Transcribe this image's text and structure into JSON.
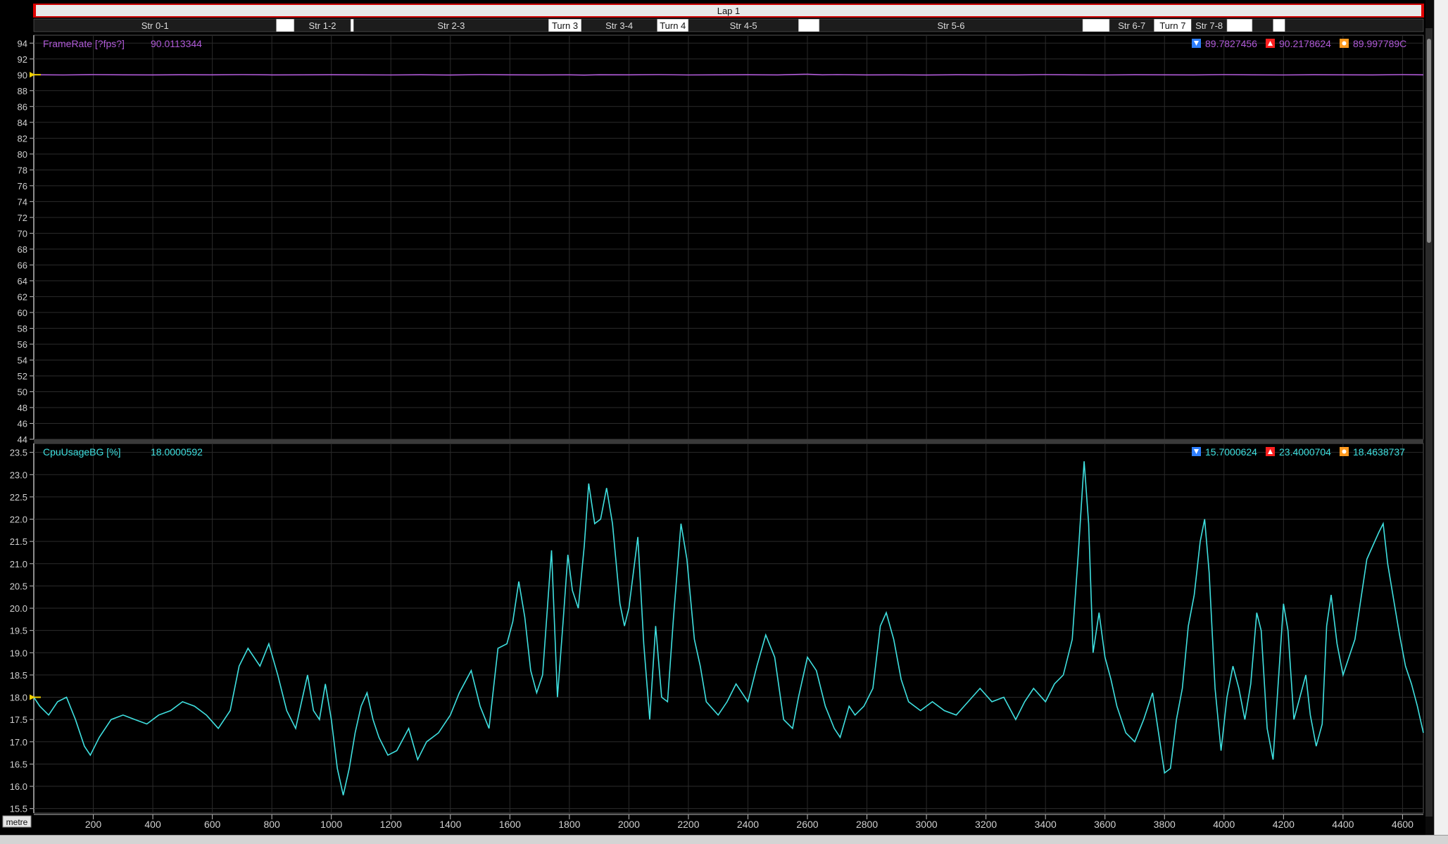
{
  "window": {
    "lap_label": "Lap 1",
    "x_unit_label": "metre",
    "colors": {
      "background": "#000000",
      "grid": "#2b2b2b",
      "framerate": "#b05ad8",
      "cpu": "#3fe0e0",
      "cursor": "#f0d000",
      "min_icon": "#2f7fff",
      "max_icon": "#ff2020",
      "avg_icon": "#ff9a20"
    }
  },
  "segments": [
    {
      "label": "Str 0-1",
      "from": 0,
      "to": 815,
      "dark": false
    },
    {
      "label": "",
      "from": 815,
      "to": 875,
      "dark": true
    },
    {
      "label": "Str 1-2",
      "from": 875,
      "to": 1065,
      "dark": false
    },
    {
      "label": "",
      "from": 1065,
      "to": 1075,
      "dark": true
    },
    {
      "label": "Str 2-3",
      "from": 1075,
      "to": 1730,
      "dark": false
    },
    {
      "label": "Turn 3",
      "from": 1730,
      "to": 1840,
      "dark": true
    },
    {
      "label": "Str 3-4",
      "from": 1840,
      "to": 2095,
      "dark": false
    },
    {
      "label": "Turn 4",
      "from": 2095,
      "to": 2200,
      "dark": true
    },
    {
      "label": "Str 4-5",
      "from": 2200,
      "to": 2570,
      "dark": false
    },
    {
      "label": "",
      "from": 2570,
      "to": 2640,
      "dark": true
    },
    {
      "label": "Str 5-6",
      "from": 2640,
      "to": 3525,
      "dark": false
    },
    {
      "label": "",
      "from": 3525,
      "to": 3615,
      "dark": true
    },
    {
      "label": "Str 6-7",
      "from": 3615,
      "to": 3765,
      "dark": false
    },
    {
      "label": "Turn 7",
      "from": 3765,
      "to": 3890,
      "dark": true
    },
    {
      "label": "Str 7-8",
      "from": 3890,
      "to": 4010,
      "dark": false
    },
    {
      "label": "",
      "from": 4010,
      "to": 4095,
      "dark": true
    },
    {
      "label": "",
      "from": 4095,
      "to": 4165,
      "dark": false
    },
    {
      "label": "",
      "from": 4165,
      "to": 4205,
      "dark": true
    },
    {
      "label": "",
      "from": 4205,
      "to": 4670,
      "dark": false
    }
  ],
  "chart_data": [
    {
      "type": "line",
      "series": [
        {
          "name": "FrameRate [?fps?]",
          "color": "#b05ad8"
        }
      ],
      "cursor_value": "90.0113344",
      "stats": {
        "min": "89.7827456",
        "max": "90.2178624",
        "avg": "89.997789C"
      },
      "x": {
        "lim": [
          0,
          4670
        ],
        "ticks": [
          200,
          400,
          600,
          800,
          1000,
          1200,
          1400,
          1600,
          1800,
          2000,
          2200,
          2400,
          2600,
          2800,
          3000,
          3200,
          3400,
          3600,
          3800,
          4000,
          4200,
          4400,
          4600
        ]
      },
      "y": {
        "lim": [
          44,
          95
        ],
        "ticks": [
          44,
          46,
          48,
          50,
          52,
          54,
          56,
          58,
          60,
          62,
          64,
          66,
          68,
          70,
          72,
          74,
          76,
          78,
          80,
          82,
          84,
          86,
          88,
          90,
          92,
          94
        ],
        "decimals": 0
      },
      "grid": true,
      "points": [
        [
          0,
          90.01
        ],
        [
          100,
          89.98
        ],
        [
          200,
          90.02
        ],
        [
          300,
          90.0
        ],
        [
          400,
          89.99
        ],
        [
          500,
          90.01
        ],
        [
          600,
          90.0
        ],
        [
          700,
          90.02
        ],
        [
          800,
          89.99
        ],
        [
          900,
          90.0
        ],
        [
          1000,
          90.01
        ],
        [
          1100,
          90.0
        ],
        [
          1200,
          89.98
        ],
        [
          1300,
          90.01
        ],
        [
          1400,
          89.97
        ],
        [
          1500,
          90.02
        ],
        [
          1600,
          90.0
        ],
        [
          1700,
          89.99
        ],
        [
          1800,
          90.0
        ],
        [
          1850,
          89.96
        ],
        [
          1900,
          90.01
        ],
        [
          2000,
          90.0
        ],
        [
          2100,
          90.02
        ],
        [
          2200,
          89.98
        ],
        [
          2300,
          90.0
        ],
        [
          2400,
          90.01
        ],
        [
          2500,
          89.99
        ],
        [
          2600,
          90.08
        ],
        [
          2650,
          90.0
        ],
        [
          2700,
          90.02
        ],
        [
          2800,
          89.99
        ],
        [
          2900,
          90.0
        ],
        [
          3000,
          89.97
        ],
        [
          3100,
          90.01
        ],
        [
          3200,
          90.0
        ],
        [
          3300,
          89.99
        ],
        [
          3400,
          90.02
        ],
        [
          3500,
          90.0
        ],
        [
          3600,
          89.98
        ],
        [
          3700,
          90.01
        ],
        [
          3800,
          90.0
        ],
        [
          3900,
          89.99
        ],
        [
          4000,
          90.02
        ],
        [
          4100,
          90.0
        ],
        [
          4200,
          89.98
        ],
        [
          4300,
          90.01
        ],
        [
          4400,
          90.0
        ],
        [
          4500,
          89.99
        ],
        [
          4600,
          90.02
        ],
        [
          4670,
          90.0
        ]
      ]
    },
    {
      "type": "line",
      "series": [
        {
          "name": "CpuUsageBG [%]",
          "color": "#3fe0e0"
        }
      ],
      "cursor_value": "18.0000592",
      "stats": {
        "min": "15.7000624",
        "max": "23.4000704",
        "avg": "18.4638737"
      },
      "x": {
        "lim": [
          0,
          4670
        ],
        "ticks": [
          200,
          400,
          600,
          800,
          1000,
          1200,
          1400,
          1600,
          1800,
          2000,
          2200,
          2400,
          2600,
          2800,
          3000,
          3200,
          3400,
          3600,
          3800,
          4000,
          4200,
          4400,
          4600
        ]
      },
      "y": {
        "lim": [
          15.4,
          23.7
        ],
        "ticks": [
          15.5,
          16.0,
          16.5,
          17.0,
          17.5,
          18.0,
          18.5,
          19.0,
          19.5,
          20.0,
          20.5,
          21.0,
          21.5,
          22.0,
          22.5,
          23.0,
          23.5
        ],
        "decimals": 1
      },
      "grid": true,
      "points": [
        [
          0,
          18.0
        ],
        [
          20,
          17.8
        ],
        [
          50,
          17.6
        ],
        [
          80,
          17.9
        ],
        [
          110,
          18.0
        ],
        [
          140,
          17.5
        ],
        [
          170,
          16.9
        ],
        [
          190,
          16.7
        ],
        [
          220,
          17.1
        ],
        [
          260,
          17.5
        ],
        [
          300,
          17.6
        ],
        [
          340,
          17.5
        ],
        [
          380,
          17.4
        ],
        [
          420,
          17.6
        ],
        [
          460,
          17.7
        ],
        [
          500,
          17.9
        ],
        [
          540,
          17.8
        ],
        [
          580,
          17.6
        ],
        [
          620,
          17.3
        ],
        [
          660,
          17.7
        ],
        [
          690,
          18.7
        ],
        [
          720,
          19.1
        ],
        [
          760,
          18.7
        ],
        [
          790,
          19.2
        ],
        [
          820,
          18.5
        ],
        [
          850,
          17.7
        ],
        [
          880,
          17.3
        ],
        [
          900,
          17.9
        ],
        [
          920,
          18.5
        ],
        [
          940,
          17.7
        ],
        [
          960,
          17.5
        ],
        [
          980,
          18.3
        ],
        [
          1000,
          17.5
        ],
        [
          1020,
          16.4
        ],
        [
          1040,
          15.8
        ],
        [
          1060,
          16.4
        ],
        [
          1080,
          17.2
        ],
        [
          1100,
          17.8
        ],
        [
          1120,
          18.1
        ],
        [
          1140,
          17.5
        ],
        [
          1160,
          17.1
        ],
        [
          1190,
          16.7
        ],
        [
          1220,
          16.8
        ],
        [
          1260,
          17.3
        ],
        [
          1290,
          16.6
        ],
        [
          1320,
          17.0
        ],
        [
          1360,
          17.2
        ],
        [
          1400,
          17.6
        ],
        [
          1430,
          18.1
        ],
        [
          1470,
          18.6
        ],
        [
          1500,
          17.8
        ],
        [
          1530,
          17.3
        ],
        [
          1560,
          19.1
        ],
        [
          1590,
          19.2
        ],
        [
          1610,
          19.7
        ],
        [
          1630,
          20.6
        ],
        [
          1650,
          19.8
        ],
        [
          1670,
          18.6
        ],
        [
          1690,
          18.1
        ],
        [
          1710,
          18.5
        ],
        [
          1740,
          21.3
        ],
        [
          1760,
          18.0
        ],
        [
          1780,
          19.8
        ],
        [
          1795,
          21.2
        ],
        [
          1810,
          20.4
        ],
        [
          1830,
          20.0
        ],
        [
          1850,
          21.4
        ],
        [
          1865,
          22.8
        ],
        [
          1885,
          21.9
        ],
        [
          1905,
          22.0
        ],
        [
          1925,
          22.7
        ],
        [
          1945,
          21.9
        ],
        [
          1970,
          20.1
        ],
        [
          1985,
          19.6
        ],
        [
          2000,
          20.0
        ],
        [
          2030,
          21.6
        ],
        [
          2050,
          19.2
        ],
        [
          2070,
          17.5
        ],
        [
          2090,
          19.6
        ],
        [
          2110,
          18.0
        ],
        [
          2130,
          17.9
        ],
        [
          2150,
          19.8
        ],
        [
          2175,
          21.9
        ],
        [
          2195,
          21.1
        ],
        [
          2220,
          19.3
        ],
        [
          2240,
          18.7
        ],
        [
          2260,
          17.9
        ],
        [
          2300,
          17.6
        ],
        [
          2330,
          17.9
        ],
        [
          2360,
          18.3
        ],
        [
          2400,
          17.9
        ],
        [
          2430,
          18.7
        ],
        [
          2460,
          19.4
        ],
        [
          2490,
          18.9
        ],
        [
          2520,
          17.5
        ],
        [
          2550,
          17.3
        ],
        [
          2570,
          18.0
        ],
        [
          2600,
          18.9
        ],
        [
          2630,
          18.6
        ],
        [
          2660,
          17.8
        ],
        [
          2690,
          17.3
        ],
        [
          2710,
          17.1
        ],
        [
          2740,
          17.8
        ],
        [
          2760,
          17.6
        ],
        [
          2790,
          17.8
        ],
        [
          2820,
          18.2
        ],
        [
          2845,
          19.6
        ],
        [
          2865,
          19.9
        ],
        [
          2890,
          19.3
        ],
        [
          2915,
          18.4
        ],
        [
          2940,
          17.9
        ],
        [
          2980,
          17.7
        ],
        [
          3020,
          17.9
        ],
        [
          3060,
          17.7
        ],
        [
          3100,
          17.6
        ],
        [
          3140,
          17.9
        ],
        [
          3180,
          18.2
        ],
        [
          3220,
          17.9
        ],
        [
          3260,
          18.0
        ],
        [
          3300,
          17.5
        ],
        [
          3330,
          17.9
        ],
        [
          3360,
          18.2
        ],
        [
          3400,
          17.9
        ],
        [
          3430,
          18.3
        ],
        [
          3460,
          18.5
        ],
        [
          3490,
          19.3
        ],
        [
          3510,
          21.2
        ],
        [
          3530,
          23.3
        ],
        [
          3545,
          21.9
        ],
        [
          3560,
          19.0
        ],
        [
          3580,
          19.9
        ],
        [
          3600,
          18.9
        ],
        [
          3620,
          18.4
        ],
        [
          3640,
          17.8
        ],
        [
          3670,
          17.2
        ],
        [
          3700,
          17.0
        ],
        [
          3730,
          17.5
        ],
        [
          3760,
          18.1
        ],
        [
          3780,
          17.2
        ],
        [
          3800,
          16.3
        ],
        [
          3820,
          16.4
        ],
        [
          3840,
          17.5
        ],
        [
          3860,
          18.2
        ],
        [
          3880,
          19.6
        ],
        [
          3900,
          20.3
        ],
        [
          3920,
          21.5
        ],
        [
          3935,
          22.0
        ],
        [
          3950,
          20.8
        ],
        [
          3970,
          18.2
        ],
        [
          3990,
          16.8
        ],
        [
          4010,
          18.0
        ],
        [
          4030,
          18.7
        ],
        [
          4050,
          18.2
        ],
        [
          4070,
          17.5
        ],
        [
          4090,
          18.3
        ],
        [
          4110,
          19.9
        ],
        [
          4125,
          19.5
        ],
        [
          4145,
          17.3
        ],
        [
          4165,
          16.6
        ],
        [
          4185,
          18.6
        ],
        [
          4200,
          20.1
        ],
        [
          4215,
          19.5
        ],
        [
          4235,
          17.5
        ],
        [
          4255,
          18.0
        ],
        [
          4275,
          18.5
        ],
        [
          4290,
          17.6
        ],
        [
          4310,
          16.9
        ],
        [
          4330,
          17.4
        ],
        [
          4345,
          19.6
        ],
        [
          4360,
          20.3
        ],
        [
          4380,
          19.2
        ],
        [
          4400,
          18.5
        ],
        [
          4420,
          18.9
        ],
        [
          4440,
          19.3
        ],
        [
          4460,
          20.2
        ],
        [
          4480,
          21.1
        ],
        [
          4500,
          21.4
        ],
        [
          4520,
          21.7
        ],
        [
          4535,
          21.9
        ],
        [
          4550,
          21.0
        ],
        [
          4570,
          20.2
        ],
        [
          4590,
          19.4
        ],
        [
          4610,
          18.7
        ],
        [
          4630,
          18.3
        ],
        [
          4650,
          17.8
        ],
        [
          4670,
          17.2
        ]
      ]
    }
  ]
}
